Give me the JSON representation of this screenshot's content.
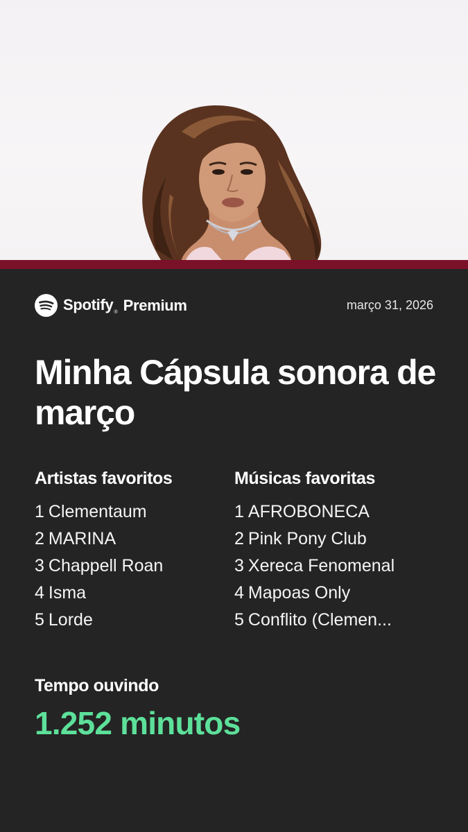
{
  "brand": {
    "name": "Spotify",
    "reg": "®",
    "tier": "Premium",
    "accent_color": "#5de09a",
    "bar_color": "#7a1129",
    "icon": "spotify-logo-icon"
  },
  "date": "março 31, 2026",
  "title": "Minha Cápsula sonora de março",
  "artists": {
    "heading": "Artistas favoritos",
    "items": [
      {
        "rank": "1",
        "name": "Clementaum"
      },
      {
        "rank": "2",
        "name": "MARINA"
      },
      {
        "rank": "3",
        "name": "Chappell Roan"
      },
      {
        "rank": "4",
        "name": "Isma"
      },
      {
        "rank": "5",
        "name": "Lorde"
      }
    ]
  },
  "songs": {
    "heading": "Músicas favoritas",
    "items": [
      {
        "rank": "1",
        "name": "AFROBONECA"
      },
      {
        "rank": "2",
        "name": "Pink Pony Club"
      },
      {
        "rank": "3",
        "name": "Xereca Fenomenal"
      },
      {
        "rank": "4",
        "name": "Mapoas Only"
      },
      {
        "rank": "5",
        "name": "Conflito (Clemen..."
      }
    ]
  },
  "listening": {
    "label": "Tempo ouvindo",
    "value": "1.252 minutos"
  }
}
